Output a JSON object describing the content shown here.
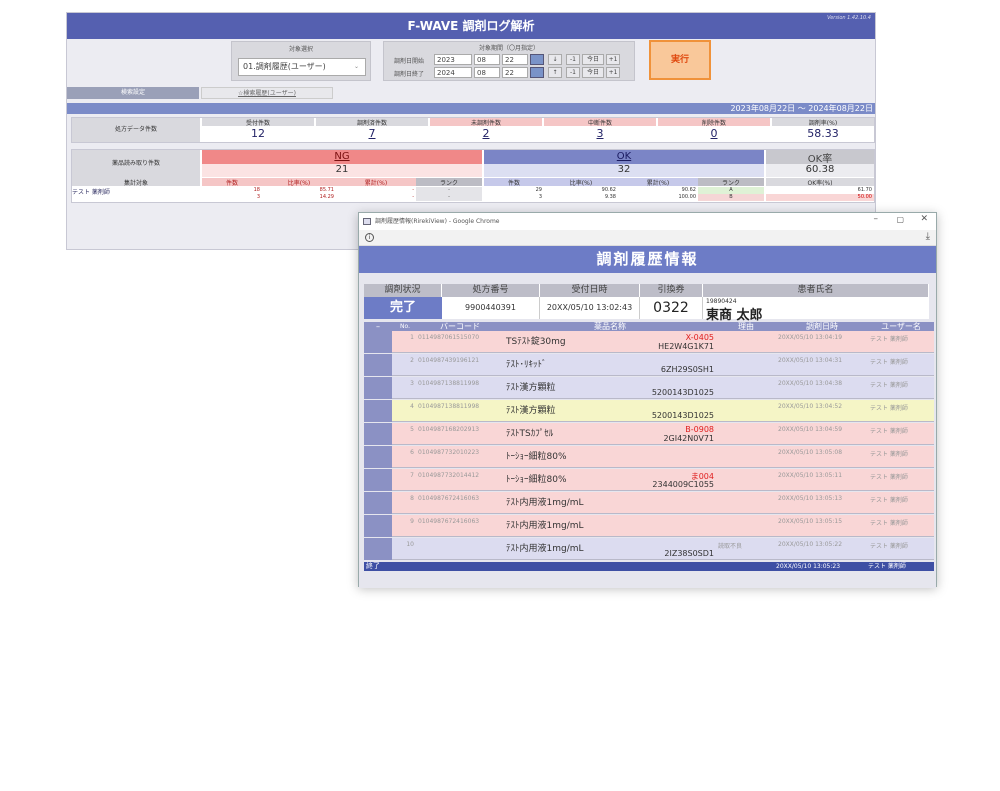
{
  "back": {
    "title": "F-WAVE 調剤ログ解析",
    "version": "Version 1.42.10.4",
    "target_label": "対象選択",
    "target_value": "01.調剤履歴(ユーザー)",
    "period_label": "対象期間（〇月指定）",
    "start_label": "調剤日開始",
    "end_label": "調剤日終了",
    "start": {
      "year": "2023",
      "month": "08",
      "day": "22"
    },
    "end": {
      "year": "2024",
      "month": "08",
      "day": "22"
    },
    "btn_down": "↓",
    "btn_up": "↑",
    "btn_minus": "-1",
    "btn_today": "今日",
    "btn_plus": "+1",
    "exec": "実行",
    "tab1": "検索設定",
    "tab2": "☆検索履歴(ユーザー)",
    "date_range": "2023年08月22日 ～ 2024年08月22日",
    "summary_headers": {
      "label": "処方データ件数",
      "accept": "受付件数",
      "done": "調剤済件数",
      "undone": "未調剤件数",
      "cancel": "中断件数",
      "delete": "削除件数",
      "rate": "調剤率(%)"
    },
    "summary_values": {
      "accept": "12",
      "done": "7",
      "undone": "2",
      "cancel": "3",
      "delete": "0",
      "rate": "58.33"
    },
    "read_label": "薬品読み取り件数",
    "ng": "NG",
    "ng_count": "21",
    "ok": "OK",
    "ok_count": "32",
    "okrate_label": "OK率",
    "okrate": "60.38",
    "agg_label": "集計対象",
    "agg_cols": {
      "count": "件数",
      "ratio": "比率(%)",
      "cum": "累計(%)",
      "rank": "ランク",
      "okcol": "OK率(%)"
    },
    "agg_user": "テスト 薬剤師",
    "agg_rows": [
      {
        "ng_count": "18",
        "ng_ratio": "85.71",
        "ng_cum": "-",
        "ng_rank": "-",
        "ok_count": "29",
        "ok_ratio": "90.62",
        "ok_cum": "90.62",
        "ok_rank": "A",
        "okrate": "61.70"
      },
      {
        "ng_count": "3",
        "ng_ratio": "14.29",
        "ng_cum": "-",
        "ng_rank": "-",
        "ok_count": "3",
        "ok_ratio": "9.38",
        "ok_cum": "100.00",
        "ok_rank": "B",
        "okrate": "50.00"
      }
    ]
  },
  "front": {
    "window_title": "調剤履歴情報(RirekiView) - Google Chrome",
    "title": "調剤履歴情報",
    "headers": {
      "status": "調剤状況",
      "rx": "処方番号",
      "received": "受付日時",
      "ticket": "引換券",
      "patient": "患者氏名"
    },
    "status": "完了",
    "rx": "9900440391",
    "received": "20XX/05/10 13:02:43",
    "ticket": "0322",
    "birth": "19890424",
    "patient": "東商 太郎",
    "cols": {
      "no": "No.",
      "barcode": "バーコード",
      "drug": "薬品名称",
      "reason": "理由",
      "date": "調剤日時",
      "user": "ユーザー名"
    },
    "rows": [
      {
        "no": "1",
        "barcode": "0114987061515070",
        "drug": "TSﾃｽﾄ錠30mg",
        "err": "X-0405",
        "code": "HE2W4G1K71",
        "reason": "",
        "date": "20XX/05/10 13:04:19",
        "user": "テスト 薬剤師"
      },
      {
        "no": "2",
        "barcode": "0104987439196121",
        "drug": "ﾃｽﾄ･ﾘｷｯﾄﾞ",
        "err": "",
        "code": "6ZH29S0SH1",
        "reason": "",
        "date": "20XX/05/10 13:04:31",
        "user": "テスト 薬剤師"
      },
      {
        "no": "3",
        "barcode": "0104987138811998",
        "drug": "ﾃｽﾄ漢方顆粒",
        "err": "",
        "code": "5200143D1025",
        "reason": "",
        "date": "20XX/05/10 13:04:38",
        "user": "テスト 薬剤師"
      },
      {
        "no": "4",
        "barcode": "0104987138811998",
        "drug": "ﾃｽﾄ漢方顆粒",
        "err": "",
        "code": "5200143D1025",
        "reason": "",
        "date": "20XX/05/10 13:04:52",
        "user": "テスト 薬剤師"
      },
      {
        "no": "5",
        "barcode": "0104987168202913",
        "drug": "ﾃｽﾄTSｶﾌﾟｾﾙ",
        "err": "B-0908",
        "code": "2GI42N0V71",
        "reason": "",
        "date": "20XX/05/10 13:04:59",
        "user": "テスト 薬剤師"
      },
      {
        "no": "6",
        "barcode": "0104987732010223",
        "drug": "ﾄｰｼｮｰ細粒80%",
        "err": "",
        "code": "",
        "reason": "",
        "date": "20XX/05/10 13:05:08",
        "user": "テスト 薬剤師"
      },
      {
        "no": "7",
        "barcode": "0104987732014412",
        "drug": "ﾄｰｼｮｰ細粒80%",
        "err": "ま004",
        "code": "2344009C1055",
        "reason": "",
        "date": "20XX/05/10 13:05:11",
        "user": "テスト 薬剤師"
      },
      {
        "no": "8",
        "barcode": "0104987672416063",
        "drug": "ﾃｽﾄ内用液1mg/mL",
        "err": "",
        "code": "",
        "reason": "",
        "date": "20XX/05/10 13:05:13",
        "user": "テスト 薬剤師"
      },
      {
        "no": "9",
        "barcode": "0104987672416063",
        "drug": "ﾃｽﾄ内用液1mg/mL",
        "err": "",
        "code": "",
        "reason": "",
        "date": "20XX/05/10 13:05:15",
        "user": "テスト 薬剤師"
      },
      {
        "no": "10",
        "barcode": "",
        "drug": "ﾃｽﾄ内用液1mg/mL",
        "err": "",
        "code": "2IZ38S0SD1",
        "reason": "読取不良",
        "date": "20XX/05/10 13:05:22",
        "user": "テスト 薬剤師"
      }
    ],
    "end_label": "終了",
    "end_date": "20XX/05/10 13:05:23",
    "end_user": "テスト 薬剤師",
    "row_colors": [
      "#f9d6d6",
      "#dcdcf0",
      "#dcdcf0",
      "#f5f5c6",
      "#f9d6d6",
      "#f9d6d6",
      "#f9d6d6",
      "#f9d6d6",
      "#f9d6d6",
      "#dcdcf0"
    ]
  }
}
